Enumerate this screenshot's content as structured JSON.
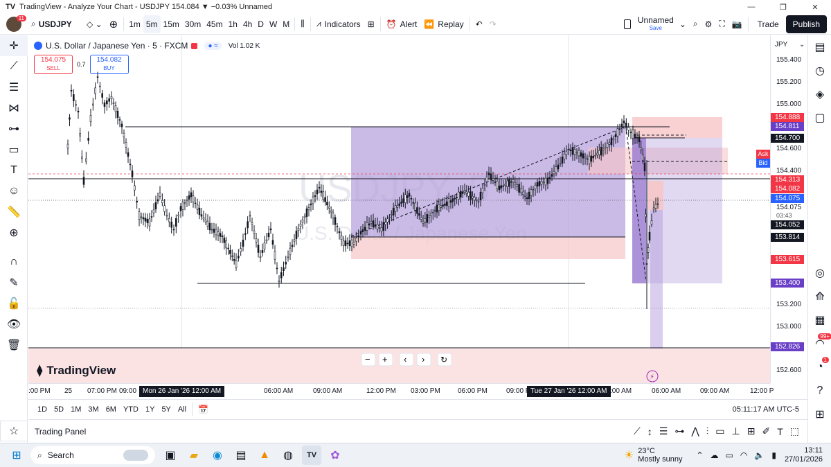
{
  "window": {
    "title": "TradingView - Analyze Your Chart - USDJPY 154.084 ▼ −0.03% Unnamed",
    "logo": "TV",
    "minimize": "—",
    "maximize": "❐",
    "close": "✕"
  },
  "toolbar": {
    "avatar_badge": "11",
    "symbol": "USDJPY",
    "intervals": [
      "1m",
      "5m",
      "15m",
      "30m",
      "45m",
      "1h",
      "4h",
      "D",
      "W",
      "M"
    ],
    "active_interval": "5m",
    "indicators": "Indicators",
    "alert": "Alert",
    "replay": "Replay",
    "layout_name": "Unnamed",
    "layout_save": "Save",
    "trade": "Trade",
    "publish": "Publish"
  },
  "legend": {
    "title": "U.S. Dollar / Japanese Yen · 5 · FXCM",
    "vol": "Vol 1.02 K",
    "sell_price": "154.075",
    "sell_label": "SELL",
    "spread": "0.7",
    "buy_price": "154.082",
    "buy_label": "BUY"
  },
  "watermark": {
    "symbol": "USDJPY, 5",
    "name": "U.S. Dollar / Japanese Yen"
  },
  "logo_text": "TradingView",
  "price_scale": {
    "currency": "JPY",
    "ticks": [
      "155.400",
      "155.200",
      "155.000",
      "154.600",
      "154.400",
      "154.075",
      "152.600",
      "153.200",
      "153.000"
    ],
    "countdown": "03:43",
    "tags": [
      {
        "text": "154.888",
        "color": "#f23645"
      },
      {
        "text": "154.811",
        "color": "#6a3fc7"
      },
      {
        "text": "154.700",
        "color": "#131722"
      },
      {
        "text": "154.313",
        "color": "#f23645"
      },
      {
        "text": "154.082",
        "color": "#f23645"
      },
      {
        "text": "154.075",
        "color": "#2962ff"
      },
      {
        "text": "154.052",
        "color": "#131722"
      },
      {
        "text": "153.814",
        "color": "#131722"
      },
      {
        "text": "153.615",
        "color": "#f23645"
      },
      {
        "text": "153.400",
        "color": "#6a3fc7"
      },
      {
        "text": "152.826",
        "color": "#6a3fc7"
      }
    ],
    "ask_label": "Ask",
    "bid_label": "Bid"
  },
  "time_axis": {
    "labels": [
      ":00 PM",
      "25",
      "07:00 PM",
      "09:00",
      "12:00 AM",
      "06:00 AM",
      "09:00 AM",
      "12:00 PM",
      "03:00 PM",
      "06:00 PM",
      "09:00 P",
      "12:00 AM",
      "06:00 AM",
      "09:00 AM",
      "12:00 P"
    ],
    "highlight1": "Mon 26 Jan '26   12:00 AM",
    "highlight2": "Tue 27 Jan '26   12:00 AM",
    "partial": ":00 AM"
  },
  "ranges": [
    "1D",
    "5D",
    "1M",
    "3M",
    "6M",
    "YTD",
    "1Y",
    "5Y",
    "All"
  ],
  "clock": "05:11:17 AM UTC-5",
  "trading_panel": "Trading Panel",
  "taskbar": {
    "search": "Search",
    "temp": "23°C",
    "weather": "Mostly sunny",
    "time": "13:11",
    "date": "27/01/2026",
    "notif": "99+"
  },
  "colors": {
    "purple_box": "#b39ddb",
    "red_box": "#f7c6c7",
    "accent": "#2962ff"
  }
}
